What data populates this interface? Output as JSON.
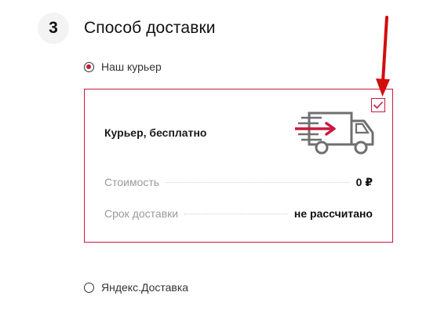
{
  "step": {
    "number": "3",
    "title": "Способ доставки"
  },
  "options": {
    "courier": {
      "label": "Наш курьер",
      "selected": true
    },
    "yandex": {
      "label": "Яндекс.Доставка",
      "selected": false
    }
  },
  "courier_card": {
    "title": "Курьер, бесплатно",
    "checked": true,
    "cost_label": "Стоимость",
    "cost_value": "0 ₽",
    "term_label": "Срок доставки",
    "term_value": "не рассчитано"
  },
  "icons": {
    "checkmark": "check-icon",
    "truck": "truck-icon",
    "annotation": "red-arrow-icon"
  },
  "colors": {
    "accent": "#c8193f",
    "annotation": "#d10e0e",
    "truck_gray": "#6f6f6f",
    "muted_text": "#9a9a9a"
  }
}
